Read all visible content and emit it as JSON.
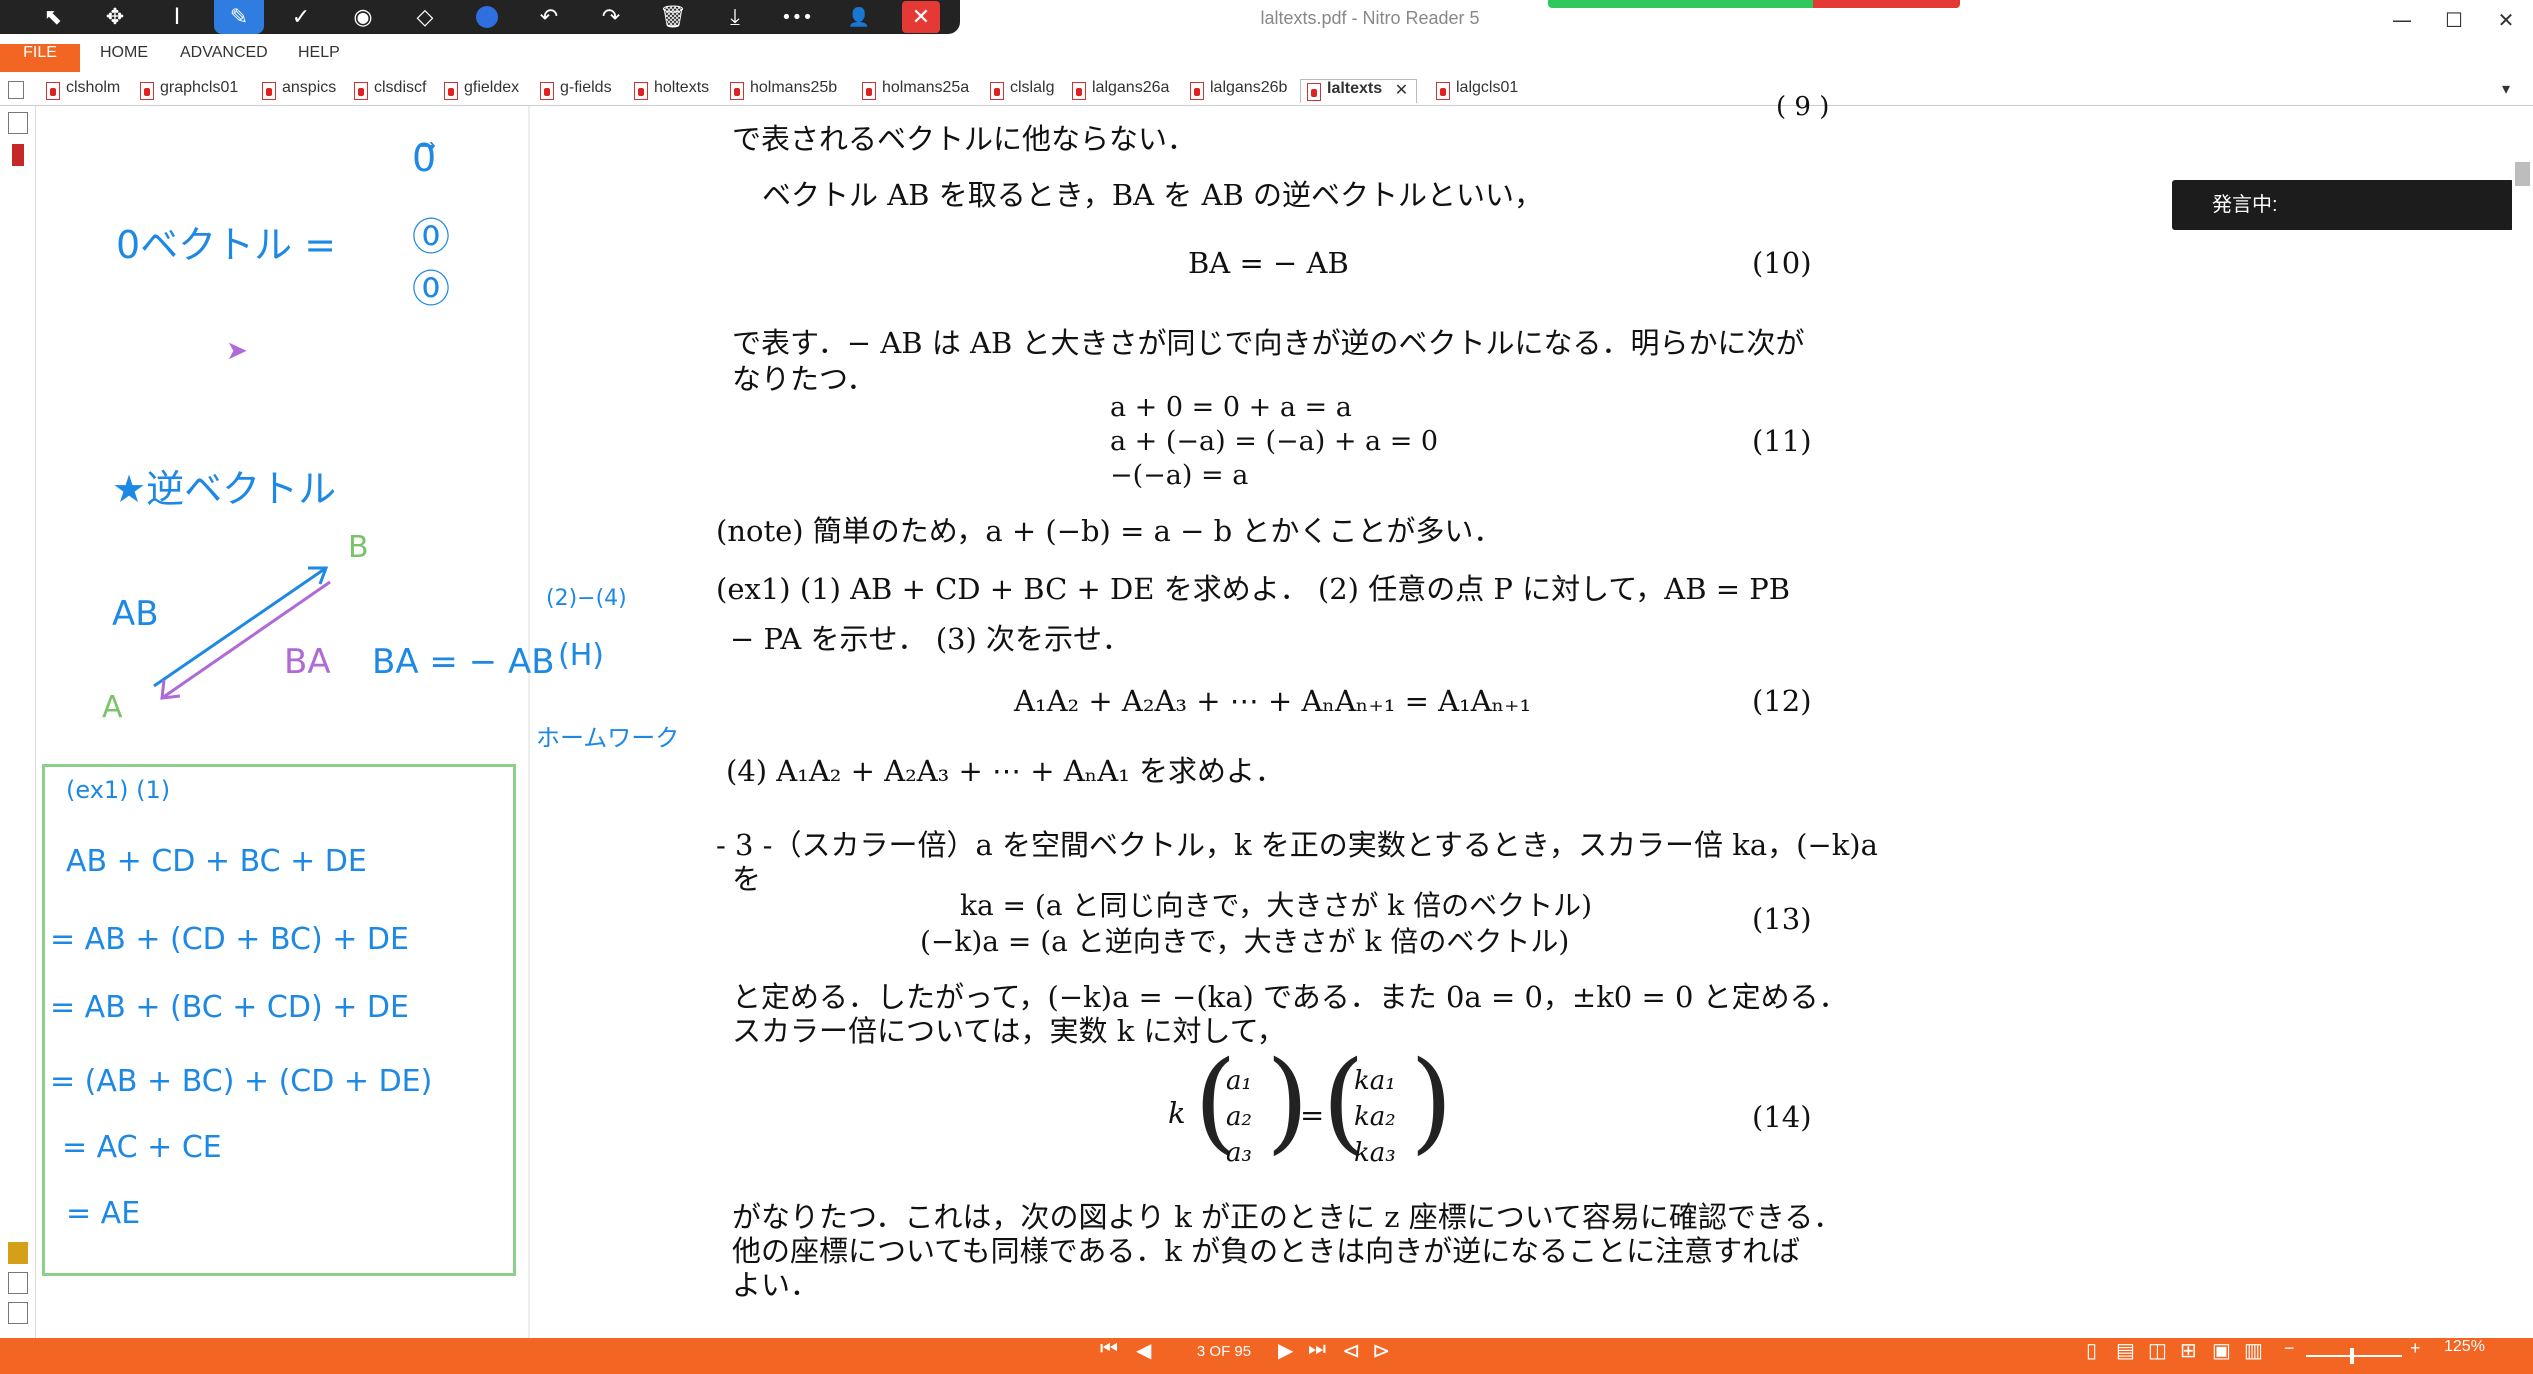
{
  "window": {
    "title": "laltexts.pdf - Nitro Reader 5",
    "minimize": "—",
    "maximize": "☐",
    "close": "✕"
  },
  "pen_toolbar": {
    "tools": [
      "⬉",
      "✥",
      "I",
      "✎",
      "✓",
      "◉",
      "◇",
      "●",
      "↶",
      "↷",
      "🗑",
      "⤓",
      "•••",
      "👤",
      "✕"
    ]
  },
  "menu": {
    "file": "FILE",
    "home": "HOME",
    "advanced": "ADVANCED",
    "help": "HELP"
  },
  "tabs": [
    "clsholm",
    "graphcls01",
    "anspics",
    "clsdiscf",
    "gfieldex",
    "g-fields",
    "holtexts",
    "holmans25b",
    "holmans25a",
    "clslalg",
    "lalgans26a",
    "lalgans26b",
    "laltexts",
    "lalgcls01"
  ],
  "active_tab": "laltexts",
  "tab_close": "✕",
  "page": {
    "l1": "で表されるベクトルに他ならない．",
    "l2": "ベクトル AB を取るとき，BA を AB の逆ベクトルといい，",
    "eq10": "BA = − AB",
    "n10": "(10)",
    "l3": "で表す．− AB は AB と大きさが同じで向きが逆のベクトルになる．明らかに次が",
    "l4": "なりたつ．",
    "eq11a": "a + 0 = 0 + a = a",
    "eq11b": "a + (−a) = (−a) + a = 0",
    "eq11c": "−(−a) = a",
    "n11": "(11)",
    "note": "(note) 簡単のため，a + (−b) = a − b とかくことが多い．",
    "ex1a": "(ex1) (1) AB + CD + BC + DE を求めよ．  (2) 任意の点 P に対して，AB = PB",
    "ex1b": "− PA を示せ．  (3) 次を示せ．",
    "eq12": "A₁A₂ + A₂A₃ + ⋯ + AₙAₙ₊₁ = A₁Aₙ₊₁",
    "n12": "(12)",
    "ex4": "(4) A₁A₂ + A₂A₃ + ⋯ + AₙA₁ を求めよ．",
    "s3a": "- 3 -（スカラー倍）a を空間ベクトル，k を正の実数とするとき，スカラー倍 ka，(−k)a",
    "s3b": "を",
    "eq13a": "ka   = (a と同じ向きで，大きさが k 倍のベクトル)",
    "eq13b": "(−k)a   = (a と逆向きで，大きさが k 倍のベクトル)",
    "n13": "(13)",
    "l5": "と定める．したがって，(−k)a = −(ka) である．また 0a = 0，±k0 = 0 と定める．",
    "l6": "スカラー倍については，実数 k に対して，",
    "eq14k": "k",
    "eq14a": [
      "a₁",
      "a₂",
      "a₃"
    ],
    "eq14eq": "=",
    "eq14b": [
      "ka₁",
      "ka₂",
      "ka₃"
    ],
    "n14": "(14)",
    "l7": "がなりたつ．これは，次の図より k が正のときに z 座標について容易に確認できる．",
    "l8": "他の座標についても同様である．k が負のときは向きが逆になることに注意すれば",
    "l9": "よい．",
    "top_partial": "( 9 )"
  },
  "speaking": "発言中:",
  "ink": {
    "zero_vec": "0ベクトル =",
    "zero_col": [
      "0⃗",
      "⓪",
      "⓪"
    ],
    "inverse": "★逆ベクトル",
    "ab": "AB",
    "b": "B",
    "a": "A",
    "ba_eq": "BA = − AB",
    "side1": "(2)−(4)",
    "side2": "(H)",
    "side3": "ホームワーク",
    "box": [
      "(ex1) (1)",
      "AB + CD + BC + DE",
      "= AB + (CD + BC) + DE",
      "= AB + (BC + CD) + DE",
      "= (AB + BC) + (CD + DE)",
      "= AC + CE",
      "= AE"
    ]
  },
  "status": {
    "page_indicator": "3 OF 95",
    "zoom": "125%",
    "zoom_minus": "−",
    "zoom_plus": "+"
  },
  "colors": {
    "accent": "#f26522",
    "ink_blue": "#1e88e5",
    "ink_purple": "#b06ad8",
    "ink_green": "#79c36b"
  }
}
